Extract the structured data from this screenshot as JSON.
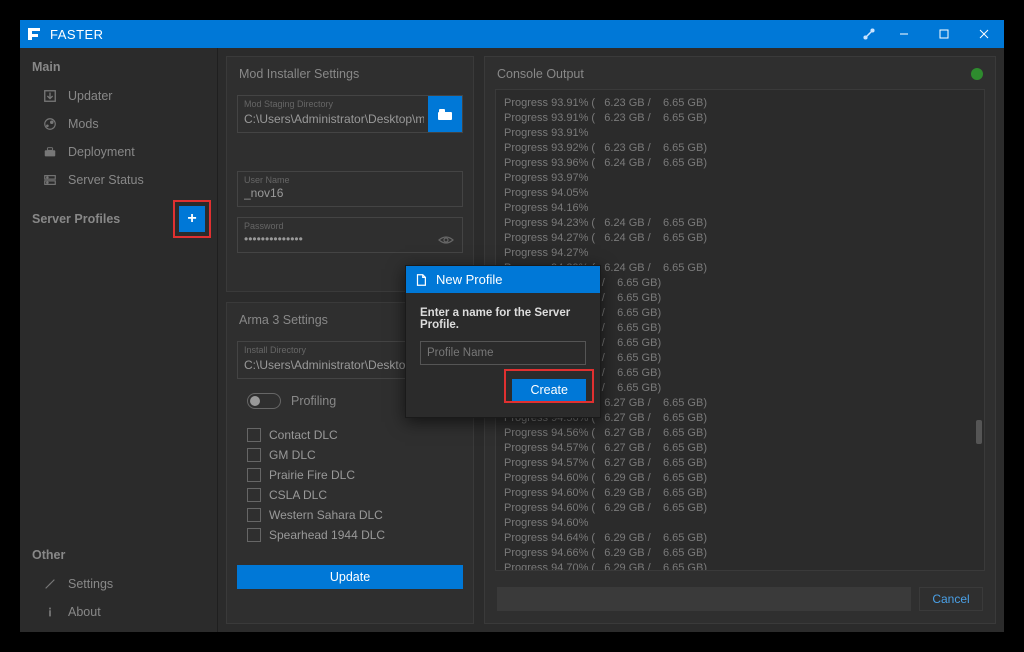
{
  "app": {
    "title": "FASTER"
  },
  "sidebar": {
    "main_label": "Main",
    "items": [
      {
        "label": "Updater"
      },
      {
        "label": "Mods"
      },
      {
        "label": "Deployment"
      },
      {
        "label": "Server Status"
      }
    ],
    "profiles_label": "Server Profiles",
    "other_label": "Other",
    "other_items": [
      {
        "label": "Settings"
      },
      {
        "label": "About"
      }
    ]
  },
  "mod_installer": {
    "title": "Mod Installer Settings",
    "staging_label": "Mod Staging Directory",
    "staging_value": "C:\\Users\\Administrator\\Desktop\\mod",
    "username_label": "User Name",
    "username_value": "_nov16",
    "password_label": "Password",
    "password_value": "••••••••••••••"
  },
  "arma": {
    "title": "Arma 3 Settings",
    "install_label": "Install Directory",
    "install_value": "C:\\Users\\Administrator\\Desktop\\serve",
    "profiling_label": "Profiling",
    "dlcs": [
      "Contact DLC",
      "GM DLC",
      "Prairie Fire DLC",
      "CSLA DLC",
      "Western Sahara DLC",
      "Spearhead 1944 DLC"
    ],
    "update_label": "Update"
  },
  "console": {
    "title": "Console Output",
    "cancel_label": "Cancel",
    "lines": [
      "Progress 93.91% (   6.23 GB /    6.65 GB)",
      "Progress 93.91% (   6.23 GB /    6.65 GB)",
      "Progress 93.91%",
      "Progress 93.92% (   6.23 GB /    6.65 GB)",
      "Progress 93.96% (   6.24 GB /    6.65 GB)",
      "Progress 93.97%",
      "Progress 94.05%",
      "Progress 94.16%",
      "Progress 94.23% (   6.24 GB /    6.65 GB)",
      "Progress 94.27% (   6.24 GB /    6.65 GB)",
      "Progress 94.27%",
      "Progress 94.29% (   6.24 GB /    6.65 GB)",
      "                             3 /    6.65 GB)",
      "                             3 /    6.65 GB)",
      "                             3 /    6.65 GB)",
      "                             3 /    6.65 GB)",
      "",
      "                             3 /    6.65 GB)",
      "",
      "                             3 /    6.65 GB)",
      "                             3 /    6.65 GB)",
      "                             3 /    6.65 GB)",
      "Progress 94.56% (   6.27 GB /    6.65 GB)",
      "Progress 94.56% (   6.27 GB /    6.65 GB)",
      "Progress 94.56% (   6.27 GB /    6.65 GB)",
      "Progress 94.57% (   6.27 GB /    6.65 GB)",
      "Progress 94.57% (   6.27 GB /    6.65 GB)",
      "Progress 94.60% (   6.29 GB /    6.65 GB)",
      "Progress 94.60% (   6.29 GB /    6.65 GB)",
      "Progress 94.60% (   6.29 GB /    6.65 GB)",
      "Progress 94.60%",
      "Progress 94.64% (   6.29 GB /    6.65 GB)",
      "Progress 94.66% (   6.29 GB /    6.65 GB)",
      "Progress 94.70% (   6.29 GB /    6.65 GB)"
    ]
  },
  "modal": {
    "title": "New Profile",
    "prompt": "Enter a name for the Server Profile.",
    "placeholder": "Profile Name",
    "create_label": "Create"
  }
}
